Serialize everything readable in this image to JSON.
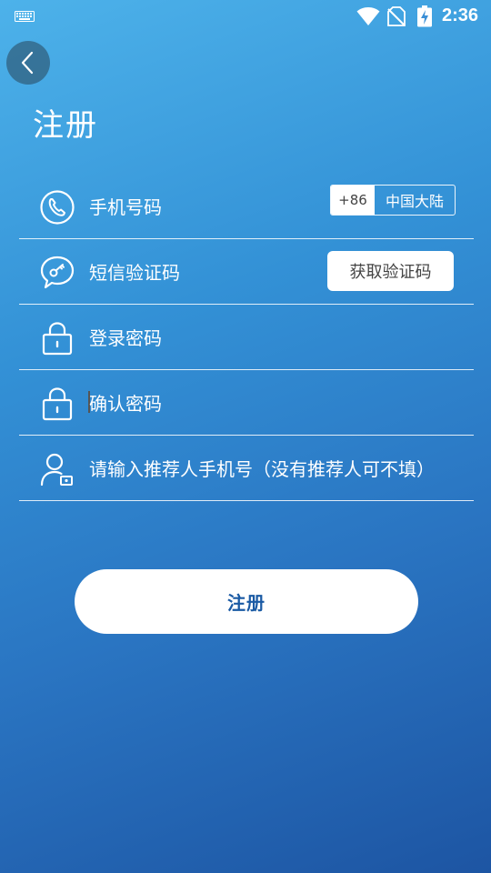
{
  "status_bar": {
    "time": "2:36"
  },
  "header": {
    "title": "注册"
  },
  "form": {
    "phone": {
      "label": "手机号码",
      "country_code": "+86",
      "country_region": "中国大陆"
    },
    "sms": {
      "label": "短信验证码",
      "get_code_button": "获取验证码"
    },
    "password": {
      "label": "登录密码"
    },
    "confirm_password": {
      "label": "确认密码"
    },
    "referrer": {
      "label": "请输入推荐人手机号（没有推荐人可不填）"
    }
  },
  "submit": {
    "label": "注册"
  },
  "colors": {
    "accent": "#1a5aa4",
    "gradient_top": "#4db2ea",
    "gradient_bottom": "#1d55a3"
  }
}
